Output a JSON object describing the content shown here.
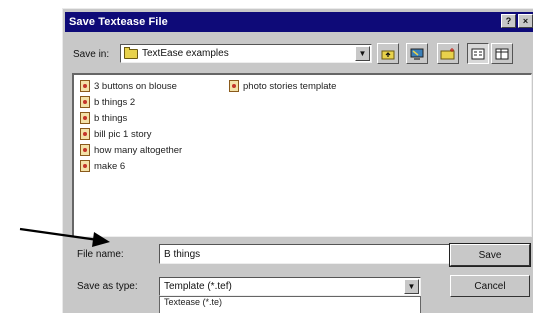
{
  "dialog": {
    "title": "Save Textease File",
    "title_buttons": [
      "?",
      "×"
    ],
    "title_bar_color": "#0e0a78"
  },
  "save_in": {
    "label": "Save in:",
    "folder": "TextEase examples"
  },
  "toolbar": {
    "icons": [
      "up-folder-icon",
      "desktop-icon",
      "new-folder-icon",
      "list-view-icon",
      "details-view-icon"
    ]
  },
  "files": [
    {
      "name": "3 buttons on blouse"
    },
    {
      "name": "b things 2"
    },
    {
      "name": "b things"
    },
    {
      "name": "bill pic 1 story"
    },
    {
      "name": "how many altogether"
    },
    {
      "name": "make 6"
    },
    {
      "name": "photo stories template"
    }
  ],
  "file_name": {
    "label": "File name:",
    "value": "B things"
  },
  "save_as_type": {
    "label": "Save as type:",
    "value": "Template (*.tef)",
    "dropdown_visible_option": "Textease (*.te)"
  },
  "buttons": {
    "save": "Save",
    "cancel": "Cancel"
  },
  "annotation": {
    "arrow_color": "#000000"
  }
}
